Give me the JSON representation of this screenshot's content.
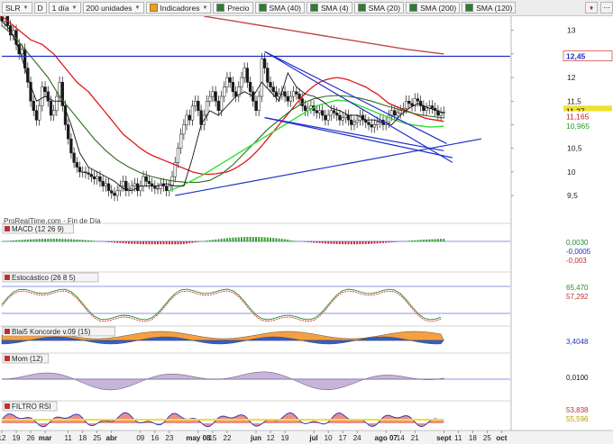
{
  "toolbar": {
    "symbol": "SLR",
    "d_label": "D",
    "period": "1 día",
    "units": "200 unidades",
    "indicators": "Indicadores",
    "chips": [
      {
        "label": "Precio",
        "color": "#2e7d32"
      },
      {
        "label": "SMA (40)",
        "color": "#2e7d32"
      },
      {
        "label": "SMA (4)",
        "color": "#2e7d32"
      },
      {
        "label": "SMA (20)",
        "color": "#2e7d32"
      },
      {
        "label": "SMA (200)",
        "color": "#2e7d32"
      },
      {
        "label": "SMA (120)",
        "color": "#2e7d32"
      }
    ]
  },
  "watermark": "ProRealTime.com - Fin de Día",
  "panels": {
    "macd": {
      "label": "MACD (12 26 9)",
      "values": [
        "0,0030",
        "-0,0005",
        "-0,003"
      ]
    },
    "stoch": {
      "label": "Estocástico (26 8 5)",
      "values": [
        "65,470",
        "57,292"
      ]
    },
    "blai5": {
      "label": "Blai5 Koncorde v.09 (15)",
      "value": "3,4048"
    },
    "mom": {
      "label": "Mom (12)",
      "value": "0,0100"
    },
    "rsi": {
      "label": "FILTRO RSI",
      "values": [
        "53,838",
        "55,596"
      ]
    }
  },
  "price_tags": {
    "horizontal_level": "12,45",
    "last": "11,27",
    "sma_red": "11,165",
    "sma_green": "10,965"
  },
  "chart_data": [
    {
      "type": "candlestick",
      "title": "SLR",
      "ylim": [
        9.1,
        13.3
      ],
      "y_ticks": [
        "13",
        "12,5",
        "12",
        "11,5",
        "11",
        "10,5",
        "10",
        "9,5"
      ],
      "y_tick_values": [
        13,
        12.5,
        12,
        11.5,
        11,
        10.5,
        10,
        9.5
      ],
      "x_ticks": [
        "12",
        "19",
        "26",
        "mar",
        "11",
        "18",
        "25",
        "abr",
        "09",
        "16",
        "23",
        "may 08",
        "15",
        "22",
        "jun",
        "12",
        "19",
        "jul",
        "10",
        "17",
        "24",
        "ago 07",
        "14",
        "21",
        "sept",
        "11",
        "18",
        "25",
        "oct"
      ],
      "x_tick_values": [
        0,
        5,
        10,
        15,
        23,
        28,
        33,
        38,
        48,
        53,
        58,
        68,
        73,
        78,
        88,
        93,
        98,
        108,
        113,
        118,
        123,
        133,
        138,
        143,
        153,
        158,
        163,
        168,
        173
      ],
      "x_range": [
        0,
        176
      ],
      "x_last_bar": 153,
      "close": [
        13.2,
        13.4,
        13.1,
        12.9,
        13.0,
        12.7,
        12.5,
        12.6,
        12.2,
        11.9,
        11.5,
        11.3,
        11.1,
        11.4,
        11.8,
        11.7,
        11.5,
        11.2,
        11.3,
        11.6,
        11.9,
        11.4,
        11.0,
        10.7,
        10.4,
        10.2,
        10.1,
        10.0,
        10.0,
        9.98,
        9.95,
        9.9,
        9.85,
        9.9,
        9.8,
        9.7,
        9.75,
        9.6,
        9.55,
        9.5,
        9.6,
        9.7,
        9.8,
        9.6,
        9.65,
        9.7,
        9.75,
        9.6,
        9.7,
        9.9,
        9.8,
        9.75,
        9.7,
        9.65,
        9.65,
        9.75,
        9.7,
        9.6,
        9.7,
        9.9,
        10.2,
        10.5,
        10.8,
        11.0,
        11.2,
        11.1,
        11.4,
        11.5,
        11.3,
        11.0,
        11.2,
        11.5,
        11.6,
        11.7,
        11.5,
        11.3,
        11.6,
        11.8,
        12.0,
        11.9,
        11.7,
        11.6,
        11.8,
        12.0,
        12.2,
        11.9,
        11.7,
        11.5,
        11.3,
        11.6,
        12.4,
        12.2,
        11.9,
        11.8,
        11.7,
        11.6,
        11.65,
        11.7,
        11.6,
        11.5,
        11.6,
        11.7,
        11.65,
        11.55,
        11.4,
        11.3,
        11.35,
        11.4,
        11.3,
        11.25,
        11.3,
        11.2,
        11.1,
        11.2,
        11.3,
        11.25,
        11.2,
        11.1,
        11.15,
        11.2,
        11.1,
        11.0,
        11.05,
        11.1,
        11.2,
        11.1,
        11.05,
        11.0,
        10.95,
        11.0,
        11.05,
        11.1,
        11.0,
        11.05,
        11.2,
        11.3,
        11.2,
        11.25,
        11.3,
        11.35,
        11.5,
        11.45,
        11.4,
        11.55,
        11.5,
        11.4,
        11.3,
        11.35,
        11.4,
        11.35,
        11.3,
        11.2,
        11.25,
        11.27
      ],
      "sma_red_120": [
        13.3,
        13.2,
        13.1,
        13.0,
        12.9,
        12.8,
        12.75,
        12.7,
        12.6,
        12.5,
        12.35,
        12.2,
        12.05,
        11.9,
        11.8,
        11.7,
        11.55,
        11.4,
        11.25,
        11.1,
        10.95,
        10.8,
        10.7,
        10.6,
        10.5,
        10.42,
        10.35,
        10.3,
        10.25,
        10.2,
        10.15,
        10.1,
        10.05,
        10.0,
        9.97,
        9.95,
        9.95,
        9.96,
        9.98,
        10.0,
        10.05,
        10.12,
        10.2,
        10.3,
        10.42,
        10.55,
        10.7,
        10.85,
        11.0,
        11.15,
        11.3,
        11.45,
        11.6,
        11.72,
        11.82,
        11.9,
        11.95,
        11.98,
        12.0,
        11.98,
        11.95,
        11.9,
        11.85,
        11.8,
        11.72,
        11.65,
        11.55,
        11.45,
        11.4,
        11.35,
        11.3,
        11.25,
        11.2,
        11.15,
        11.12,
        11.1,
        11.08,
        11.07,
        11.07,
        11.06,
        11.06,
        11.07,
        11.1,
        11.13,
        11.15,
        11.17
      ],
      "sma_red_x": [
        0,
        2,
        4,
        6,
        8,
        10,
        12,
        14,
        16,
        18,
        20,
        22,
        24,
        26,
        28,
        30,
        32,
        34,
        36,
        38,
        40,
        42,
        44,
        46,
        48,
        50,
        52,
        54,
        56,
        58,
        60,
        62,
        64,
        66,
        68,
        70,
        72,
        74,
        76,
        78,
        80,
        82,
        84,
        86,
        88,
        90,
        92,
        94,
        96,
        98,
        100,
        102,
        104,
        106,
        108,
        110,
        112,
        114,
        116,
        118,
        120,
        122,
        124,
        126,
        128,
        130,
        132,
        134,
        136,
        138,
        140,
        142,
        144,
        146,
        148,
        150,
        152,
        153
      ],
      "sma_green_40": [
        13.1,
        12.9,
        12.6,
        12.3,
        12.0,
        11.6,
        11.3,
        11.0,
        10.7,
        10.45,
        10.25,
        10.1,
        9.98,
        9.9,
        9.84,
        9.8,
        9.78,
        9.78,
        9.82,
        9.95,
        10.15,
        10.4,
        10.65,
        10.9,
        11.1,
        11.3,
        11.45,
        11.55,
        11.6,
        11.62,
        11.6,
        11.56,
        11.5,
        11.42,
        11.35,
        11.28,
        11.22,
        11.18,
        11.15,
        11.14,
        11.15,
        11.2,
        11.25,
        11.27
      ],
      "sma_green_x": [
        0,
        4,
        8,
        12,
        16,
        20,
        24,
        28,
        32,
        36,
        40,
        44,
        48,
        52,
        56,
        60,
        64,
        68,
        72,
        76,
        80,
        84,
        88,
        92,
        96,
        100,
        104,
        108,
        112,
        116,
        120,
        124,
        128,
        132,
        136,
        140,
        144,
        148,
        152,
        153,
        153,
        153,
        153,
        153
      ],
      "sma_lime_200": [
        9.6,
        9.7,
        9.82,
        9.95,
        10.1,
        10.25,
        10.4,
        10.55,
        10.7,
        10.85,
        11.0,
        11.15,
        11.3,
        11.42,
        11.52,
        11.5,
        11.4,
        11.3,
        11.2,
        11.1,
        11.02,
        10.98,
        10.95,
        10.96,
        10.97
      ],
      "sma_lime_x": [
        58,
        62,
        66,
        70,
        74,
        78,
        82,
        86,
        90,
        94,
        98,
        102,
        106,
        110,
        116,
        120,
        124,
        128,
        132,
        136,
        140,
        144,
        148,
        151,
        153
      ],
      "sma_maroon_200": [
        13.3,
        13.2,
        13.1,
        13.0,
        12.9,
        12.8,
        12.7,
        12.6,
        12.5
      ],
      "sma_maroon_x": [
        70,
        80,
        90,
        100,
        110,
        120,
        130,
        140,
        153
      ],
      "sma_black_4": [
        13.2,
        13.0,
        12.6,
        12.0,
        11.5,
        11.6,
        11.5,
        11.5,
        11.0,
        10.4,
        10.1,
        10.0,
        9.9,
        9.8,
        9.65,
        9.6,
        9.7,
        9.7,
        9.7,
        9.75,
        9.7,
        9.7,
        10.3,
        11.0,
        11.3,
        11.2,
        11.4,
        11.6,
        11.7,
        11.6,
        11.9,
        11.7,
        11.5,
        12.1,
        11.8,
        11.65,
        11.6,
        11.5,
        11.35,
        11.3,
        11.2,
        11.2,
        11.1,
        11.1,
        11.05,
        11.0,
        11.2,
        11.35,
        11.45,
        11.35,
        11.25
      ],
      "sma_black_x": [
        0,
        3,
        6,
        9,
        12,
        15,
        18,
        21,
        24,
        27,
        30,
        33,
        36,
        39,
        42,
        45,
        48,
        51,
        54,
        57,
        60,
        63,
        66,
        69,
        72,
        75,
        78,
        81,
        84,
        87,
        90,
        93,
        96,
        99,
        102,
        105,
        108,
        111,
        114,
        117,
        120,
        123,
        126,
        129,
        132,
        135,
        138,
        141,
        144,
        148,
        153
      ],
      "horizontal_line": 12.45,
      "trendlines": [
        {
          "from": [
            60,
            9.5
          ],
          "to": [
            166,
            10.7
          ]
        },
        {
          "from": [
            91,
            12.55
          ],
          "to": [
            156,
            10.2
          ]
        },
        {
          "from": [
            91,
            11.15
          ],
          "to": [
            156,
            10.3
          ]
        },
        {
          "from": [
            91,
            12.55
          ],
          "to": [
            154,
            10.6
          ]
        },
        {
          "from": [
            91,
            11.15
          ],
          "to": [
            153,
            10.45
          ]
        }
      ]
    }
  ]
}
